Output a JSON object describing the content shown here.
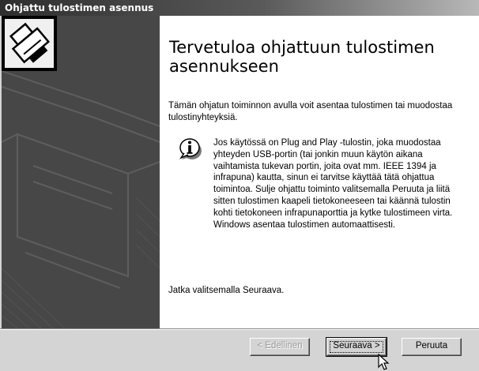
{
  "window": {
    "title": "Ohjattu tulostimen asennus"
  },
  "main": {
    "heading": "Tervetuloa ohjattuun tulostimen asennukseen",
    "intro": "Tämän ohjatun toiminnon avulla voit asentaa tulostimen tai muodostaa tulostinyhteyksiä.",
    "info": "Jos käytössä on Plug and Play -tulostin, joka muodostaa yhteyden USB-portin (tai jonkin muun käytön aikana vaihtamista tukevan portin, joita ovat mm. IEEE 1394 ja infrapuna) kautta, sinun ei tarvitse käyttää tätä ohjattua toimintoa. Sulje ohjattu toiminto valitsemalla Peruuta ja liitä sitten tulostimen kaapeli tietokoneeseen tai käännä tulostin kohti tietokoneen infrapunaporttia ja kytke tulostimeen virta. Windows asentaa tulostimen automaattisesti.",
    "next_hint": "Jatka valitsemalla Seuraava."
  },
  "buttons": {
    "back": "< Edellinen",
    "next": "Seuraava >",
    "cancel": "Peruuta"
  },
  "icons": {
    "wizard": "printer-icon",
    "info": "info-icon",
    "cursor": "mouse-pointer-icon"
  }
}
